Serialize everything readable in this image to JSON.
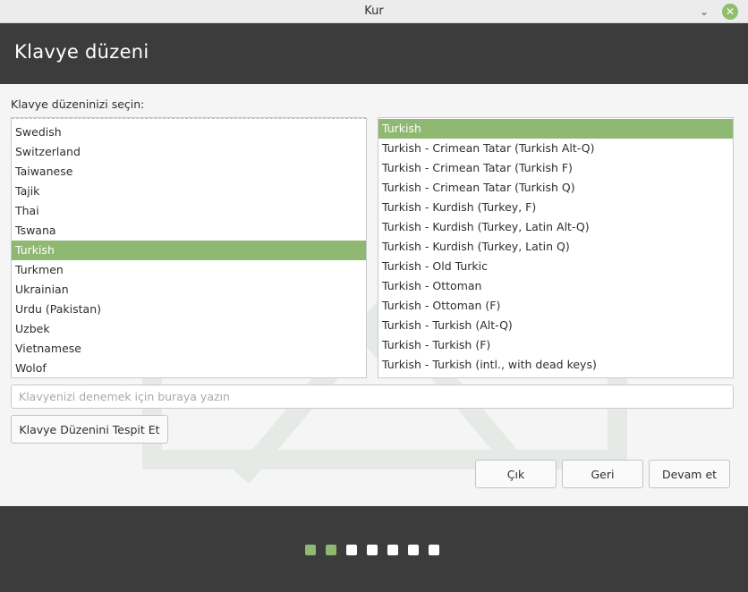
{
  "window": {
    "title": "Kur",
    "minimize_icon": "chevron-down-icon",
    "close_icon": "close-icon"
  },
  "header": {
    "title": "Klavye düzeni"
  },
  "main": {
    "prompt": "Klavye düzeninizi seçin:",
    "layouts": [
      {
        "label": "Swedish",
        "selected": false
      },
      {
        "label": "Switzerland",
        "selected": false
      },
      {
        "label": "Taiwanese",
        "selected": false
      },
      {
        "label": "Tajik",
        "selected": false
      },
      {
        "label": "Thai",
        "selected": false
      },
      {
        "label": "Tswana",
        "selected": false
      },
      {
        "label": "Turkish",
        "selected": true
      },
      {
        "label": "Turkmen",
        "selected": false
      },
      {
        "label": "Ukrainian",
        "selected": false
      },
      {
        "label": "Urdu (Pakistan)",
        "selected": false
      },
      {
        "label": "Uzbek",
        "selected": false
      },
      {
        "label": "Vietnamese",
        "selected": false
      },
      {
        "label": "Wolof",
        "selected": false
      }
    ],
    "variants": [
      {
        "label": "Turkish",
        "selected": true
      },
      {
        "label": "Turkish - Crimean Tatar (Turkish Alt-Q)",
        "selected": false
      },
      {
        "label": "Turkish - Crimean Tatar (Turkish F)",
        "selected": false
      },
      {
        "label": "Turkish - Crimean Tatar (Turkish Q)",
        "selected": false
      },
      {
        "label": "Turkish - Kurdish (Turkey, F)",
        "selected": false
      },
      {
        "label": "Turkish - Kurdish (Turkey, Latin Alt-Q)",
        "selected": false
      },
      {
        "label": "Turkish - Kurdish (Turkey, Latin Q)",
        "selected": false
      },
      {
        "label": "Turkish - Old Turkic",
        "selected": false
      },
      {
        "label": "Turkish - Ottoman",
        "selected": false
      },
      {
        "label": "Turkish - Ottoman (F)",
        "selected": false
      },
      {
        "label": "Turkish - Turkish (Alt-Q)",
        "selected": false
      },
      {
        "label": "Turkish - Turkish (F)",
        "selected": false
      },
      {
        "label": "Turkish - Turkish (intl., with dead keys)",
        "selected": false
      }
    ],
    "test_input": {
      "value": "",
      "placeholder": "Klavyenizi denemek için buraya yazın"
    },
    "detect_button": "Klavye Düzenini Tespit Et"
  },
  "actions": {
    "quit": "Çık",
    "back": "Geri",
    "continue": "Devam et"
  },
  "progress": {
    "total_steps": 7,
    "completed_steps": 2
  },
  "colors": {
    "accent": "#8fb872",
    "header_bg": "#3c3c3c",
    "content_bg": "#f5f5f5"
  }
}
